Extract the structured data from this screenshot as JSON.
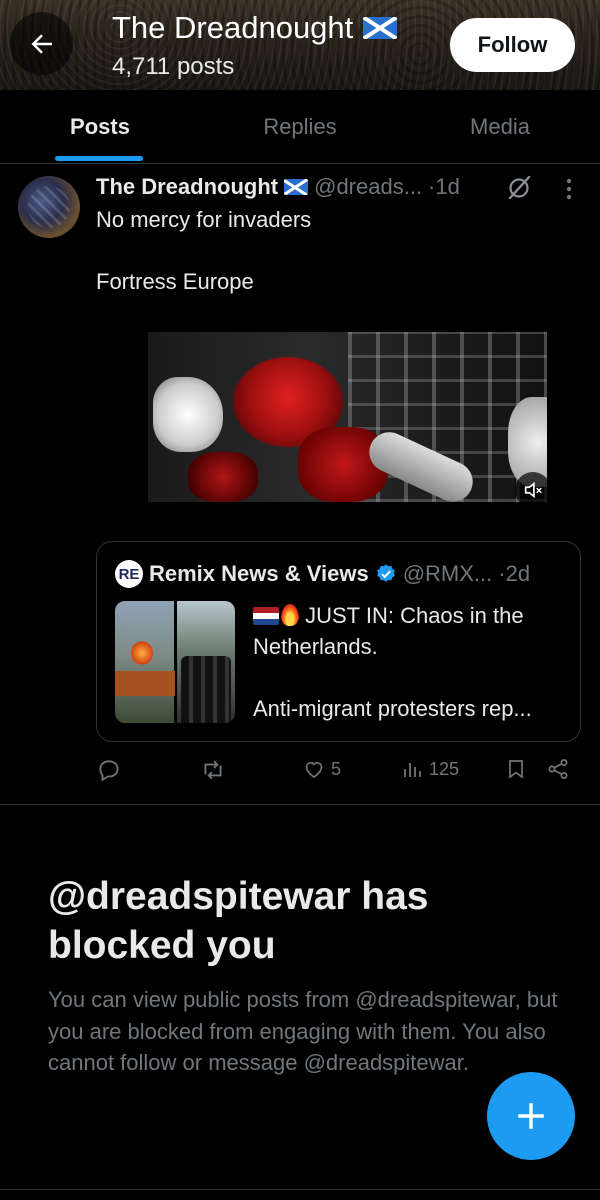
{
  "header": {
    "title": "The Dreadnought",
    "posts_count": "4,711 posts",
    "follow_label": "Follow"
  },
  "tabs": [
    {
      "label": "Posts",
      "active": true
    },
    {
      "label": "Replies",
      "active": false
    },
    {
      "label": "Media",
      "active": false
    }
  ],
  "post": {
    "author_name": "The Dreadnought",
    "handle": "@dreads...",
    "time": "·1d",
    "text_line1": "No mercy for invaders",
    "text_line2": "Fortress Europe",
    "media": {
      "type": "video",
      "muted": true
    },
    "quote": {
      "logo_text": "RE",
      "name": "Remix News & Views",
      "verified": true,
      "handle": "@RMX...",
      "time": "·2d",
      "line1": "JUST IN: Chaos in the",
      "line2": "Netherlands.",
      "line3": "Anti-migrant protesters rep..."
    },
    "actions": {
      "likes": "5",
      "views": "125"
    }
  },
  "blocked": {
    "title": "@dreadspitewar has blocked you",
    "description": "You can view public posts from @dreadspitewar, but you are blocked from engaging with them. You also cannot follow or message @dreadspitewar."
  },
  "colors": {
    "accent": "#1d9bf0",
    "background": "#000000",
    "text_primary": "#e7e9ea",
    "text_secondary": "#71767b",
    "border": "#2f3336"
  },
  "icons": {
    "back": "arrow-left-icon",
    "grok": "grok-icon",
    "more": "more-vertical-icon",
    "mute": "speaker-muted-icon",
    "reply": "reply-icon",
    "repost": "repost-icon",
    "like": "heart-icon",
    "views": "views-chart-icon",
    "bookmark": "bookmark-icon",
    "share": "share-icon",
    "compose": "plus-icon"
  }
}
